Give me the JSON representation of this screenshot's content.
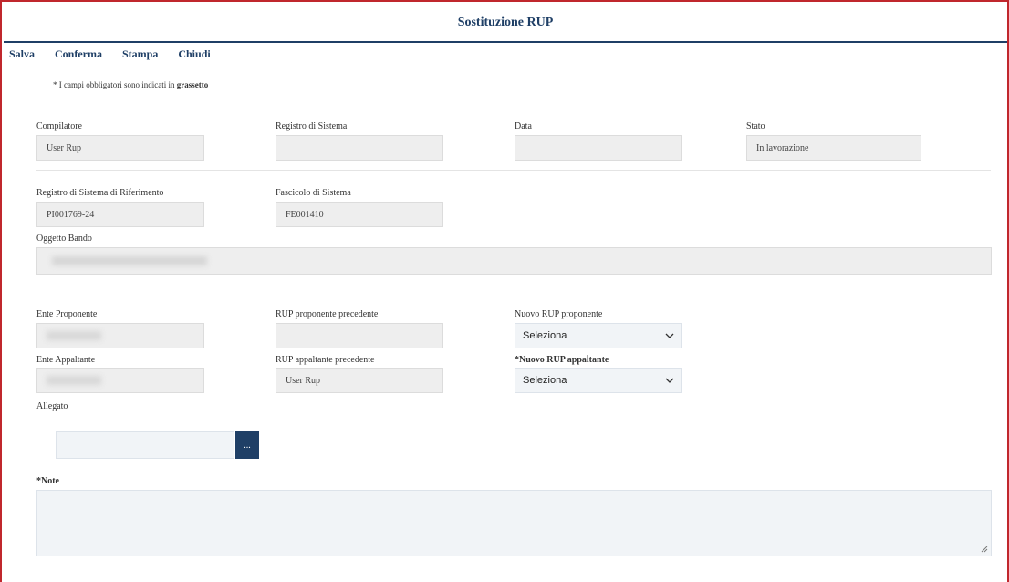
{
  "window": {
    "title": "Sostituzione RUP"
  },
  "toolbar": {
    "salva": "Salva",
    "conferma": "Conferma",
    "stampa": "Stampa",
    "chiudi": "Chiudi"
  },
  "required_note": {
    "prefix": "* I campi obbligatori sono indicati in",
    "emph": "grassetto"
  },
  "fields": {
    "compilatore": {
      "label": "Compilatore",
      "value": "User Rup"
    },
    "registro": {
      "label": "Registro di Sistema",
      "value": ""
    },
    "data": {
      "label": "Data",
      "value": ""
    },
    "stato": {
      "label": "Stato",
      "value": "In lavorazione"
    },
    "registro_rif": {
      "label": "Registro di Sistema di Riferimento",
      "value": "PI001769-24"
    },
    "fascicolo": {
      "label": "Fascicolo di Sistema",
      "value": "FE001410"
    },
    "oggetto": {
      "label": "Oggetto Bando",
      "value": ""
    },
    "ente_proponente": {
      "label": "Ente Proponente",
      "value": ""
    },
    "rup_prop_prec": {
      "label": "RUP proponente precedente",
      "value": ""
    },
    "nuovo_rup_prop": {
      "label": "Nuovo RUP proponente",
      "value": "Seleziona"
    },
    "ente_appaltante": {
      "label": "Ente Appaltante",
      "value": ""
    },
    "rup_app_prec": {
      "label": "RUP appaltante precedente",
      "value": "User Rup"
    },
    "nuovo_rup_app": {
      "label": "*Nuovo RUP appaltante",
      "value": "Seleziona"
    },
    "allegato": {
      "label": "Allegato",
      "button": "..."
    },
    "note": {
      "label": "*Note",
      "value": ""
    }
  }
}
